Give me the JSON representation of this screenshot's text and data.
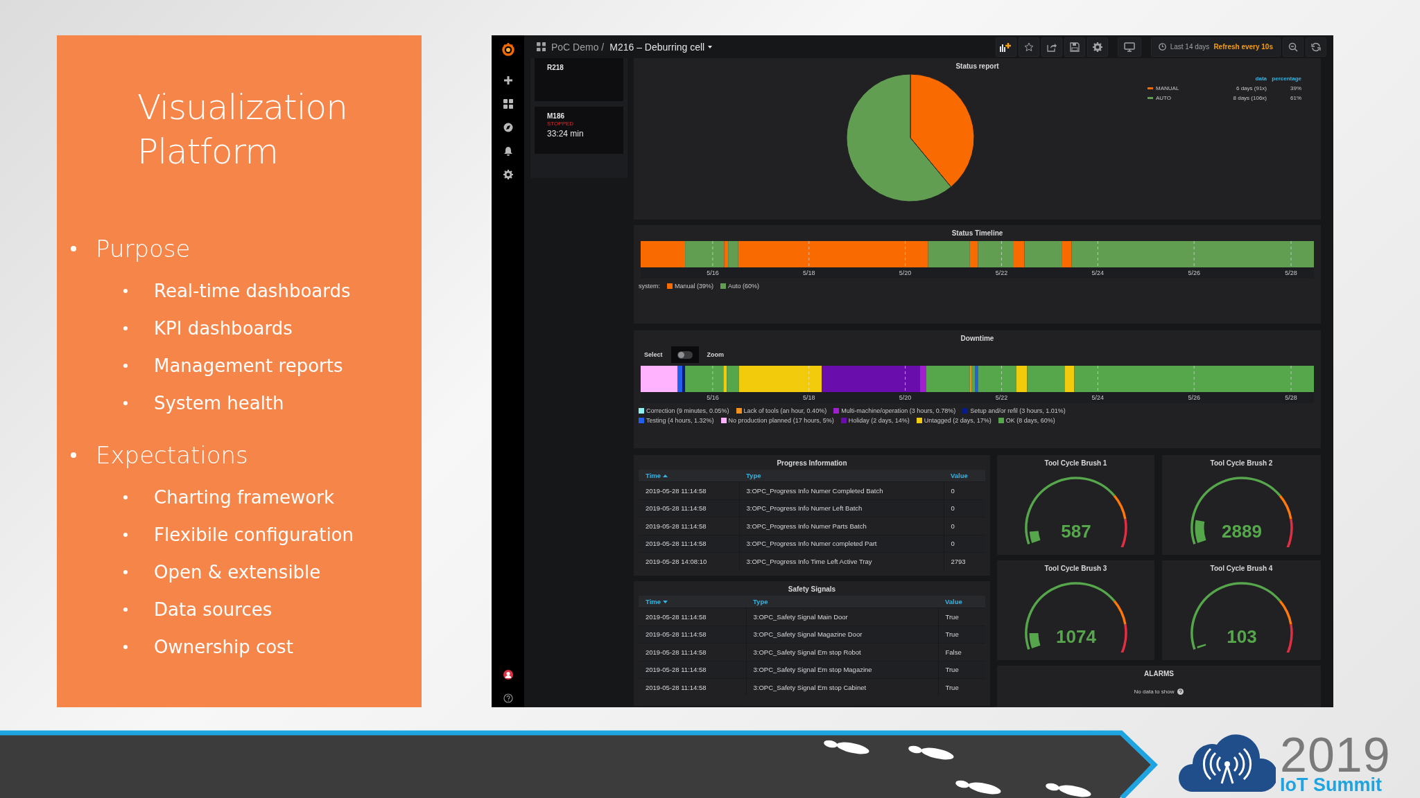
{
  "slide": {
    "title": "Visualization Platform",
    "bullets": [
      {
        "text": "Purpose",
        "children": [
          {
            "text": "Real-time dashboards"
          },
          {
            "text": "KPI dashboards"
          },
          {
            "text": "Management reports"
          },
          {
            "text": "System health"
          }
        ]
      },
      {
        "text": "Expectations",
        "children": [
          {
            "text": "Charting framework"
          },
          {
            "text": "Flexibile configuration"
          },
          {
            "text": "Open & extensible"
          },
          {
            "text": "Data sources"
          },
          {
            "text": "Ownership cost"
          }
        ]
      }
    ]
  },
  "dashboard": {
    "breadcrumb": {
      "folder": "PoC Demo /",
      "title": "M216 – Deburring cell"
    },
    "time_range": "Last 14 days",
    "refresh": "Refresh every 10s",
    "machines": [
      {
        "name": "R218"
      },
      {
        "name": "M186",
        "status": "STOPPED",
        "duration": "33:24 min"
      }
    ],
    "status_report": {
      "title": "Status report",
      "legend_headers": [
        "data",
        "percentage"
      ],
      "legend": [
        {
          "color": "#f96a00",
          "data": "6 days (91x)",
          "percentage": "39%"
        },
        {
          "color": "#629e51",
          "data": "8 days (106x)",
          "percentage": "61%"
        }
      ],
      "chart_data": {
        "type": "pie",
        "categories": [
          "MANUAL",
          "AUTO"
        ],
        "values": [
          39,
          61
        ]
      }
    },
    "status_timeline": {
      "title": "Status Timeline",
      "ticks": [
        "5/16",
        "5/18",
        "5/20",
        "5/22",
        "5/24",
        "5/26",
        "5/28"
      ],
      "legend_label": "system:",
      "legend": [
        {
          "label": "Manual (39%)",
          "color": "#f96a00"
        },
        {
          "label": "Auto (60%)",
          "color": "#629e51"
        }
      ]
    },
    "downtime": {
      "title": "Downtime",
      "select_label": "Select",
      "toggle": {
        "on": false
      },
      "zoom_label": "Zoom",
      "ticks": [
        "5/16",
        "5/18",
        "5/20",
        "5/22",
        "5/24",
        "5/26",
        "5/28"
      ],
      "legend": [
        {
          "label": "Correction (9 minutes, 0.05%)",
          "color": "#8ff0f0"
        },
        {
          "label": "Lack of tools (an hour, 0.40%)",
          "color": "#f2921d"
        },
        {
          "label": "Multi-machine/operation (3 hours, 0.78%)",
          "color": "#a020d0"
        },
        {
          "label": "Setup and/or refil (3 hours, 1.01%)",
          "color": "#0a1a8a"
        },
        {
          "label": "Testing (4 hours, 1.32%)",
          "color": "#1f60f0"
        },
        {
          "label": "No production planned (17 hours, 5%)",
          "color": "#ffb3ff"
        },
        {
          "label": "Holiday (2 days, 14%)",
          "color": "#6a0dad"
        },
        {
          "label": "Untagged (2 days, 17%)",
          "color": "#f2cc0c"
        },
        {
          "label": "OK (8 days, 60%)",
          "color": "#56a64b"
        }
      ]
    },
    "progress": {
      "title": "Progress Information",
      "columns": [
        {
          "label": "Time",
          "sorted": true,
          "ascending": true
        },
        {
          "label": "Type"
        },
        {
          "label": "Value"
        }
      ],
      "rows": [
        [
          "2019-05-28 11:14:58",
          "3:OPC_Progress Info Numer Completed Batch",
          "0"
        ],
        [
          "2019-05-28 11:14:58",
          "3:OPC_Progress Info Numer Left Batch",
          "0"
        ],
        [
          "2019-05-28 11:14:58",
          "3:OPC_Progress Info Numer Parts Batch",
          "0"
        ],
        [
          "2019-05-28 11:14:58",
          "3:OPC_Progress Info Numer completed Part",
          "0"
        ],
        [
          "2019-05-28 14:08:10",
          "3:OPC_Progress Info Time Left Active Tray",
          "2793"
        ]
      ]
    },
    "safety": {
      "title": "Safety Signals",
      "columns": [
        {
          "label": "Time",
          "sorted": true,
          "ascending": false
        },
        {
          "label": "Type"
        },
        {
          "label": "Value"
        }
      ],
      "rows": [
        [
          "2019-05-28 11:14:58",
          "3:OPC_Safety Signal Main Door",
          "True"
        ],
        [
          "2019-05-28 11:14:58",
          "3:OPC_Safety Signal Magazine Door",
          "True"
        ],
        [
          "2019-05-28 11:14:58",
          "3:OPC_Safety Signal Em stop Robot",
          "False"
        ],
        [
          "2019-05-28 11:14:58",
          "3:OPC_Safety Signal Em stop Magazine",
          "True"
        ],
        [
          "2019-05-28 11:14:58",
          "3:OPC_Safety Signal Em stop Cabinet",
          "True"
        ]
      ]
    },
    "gauges": [
      {
        "title": "Tool Cycle Brush 1",
        "value": "587"
      },
      {
        "title": "Tool Cycle Brush 2",
        "value": "2889"
      },
      {
        "title": "Tool Cycle Brush 3",
        "value": "1074"
      },
      {
        "title": "Tool Cycle Brush 4",
        "value": "103"
      }
    ],
    "alarms": {
      "title": "ALARMS",
      "message": "No data to show"
    }
  },
  "logo": {
    "year": "2019",
    "name": "IoT Summit"
  }
}
